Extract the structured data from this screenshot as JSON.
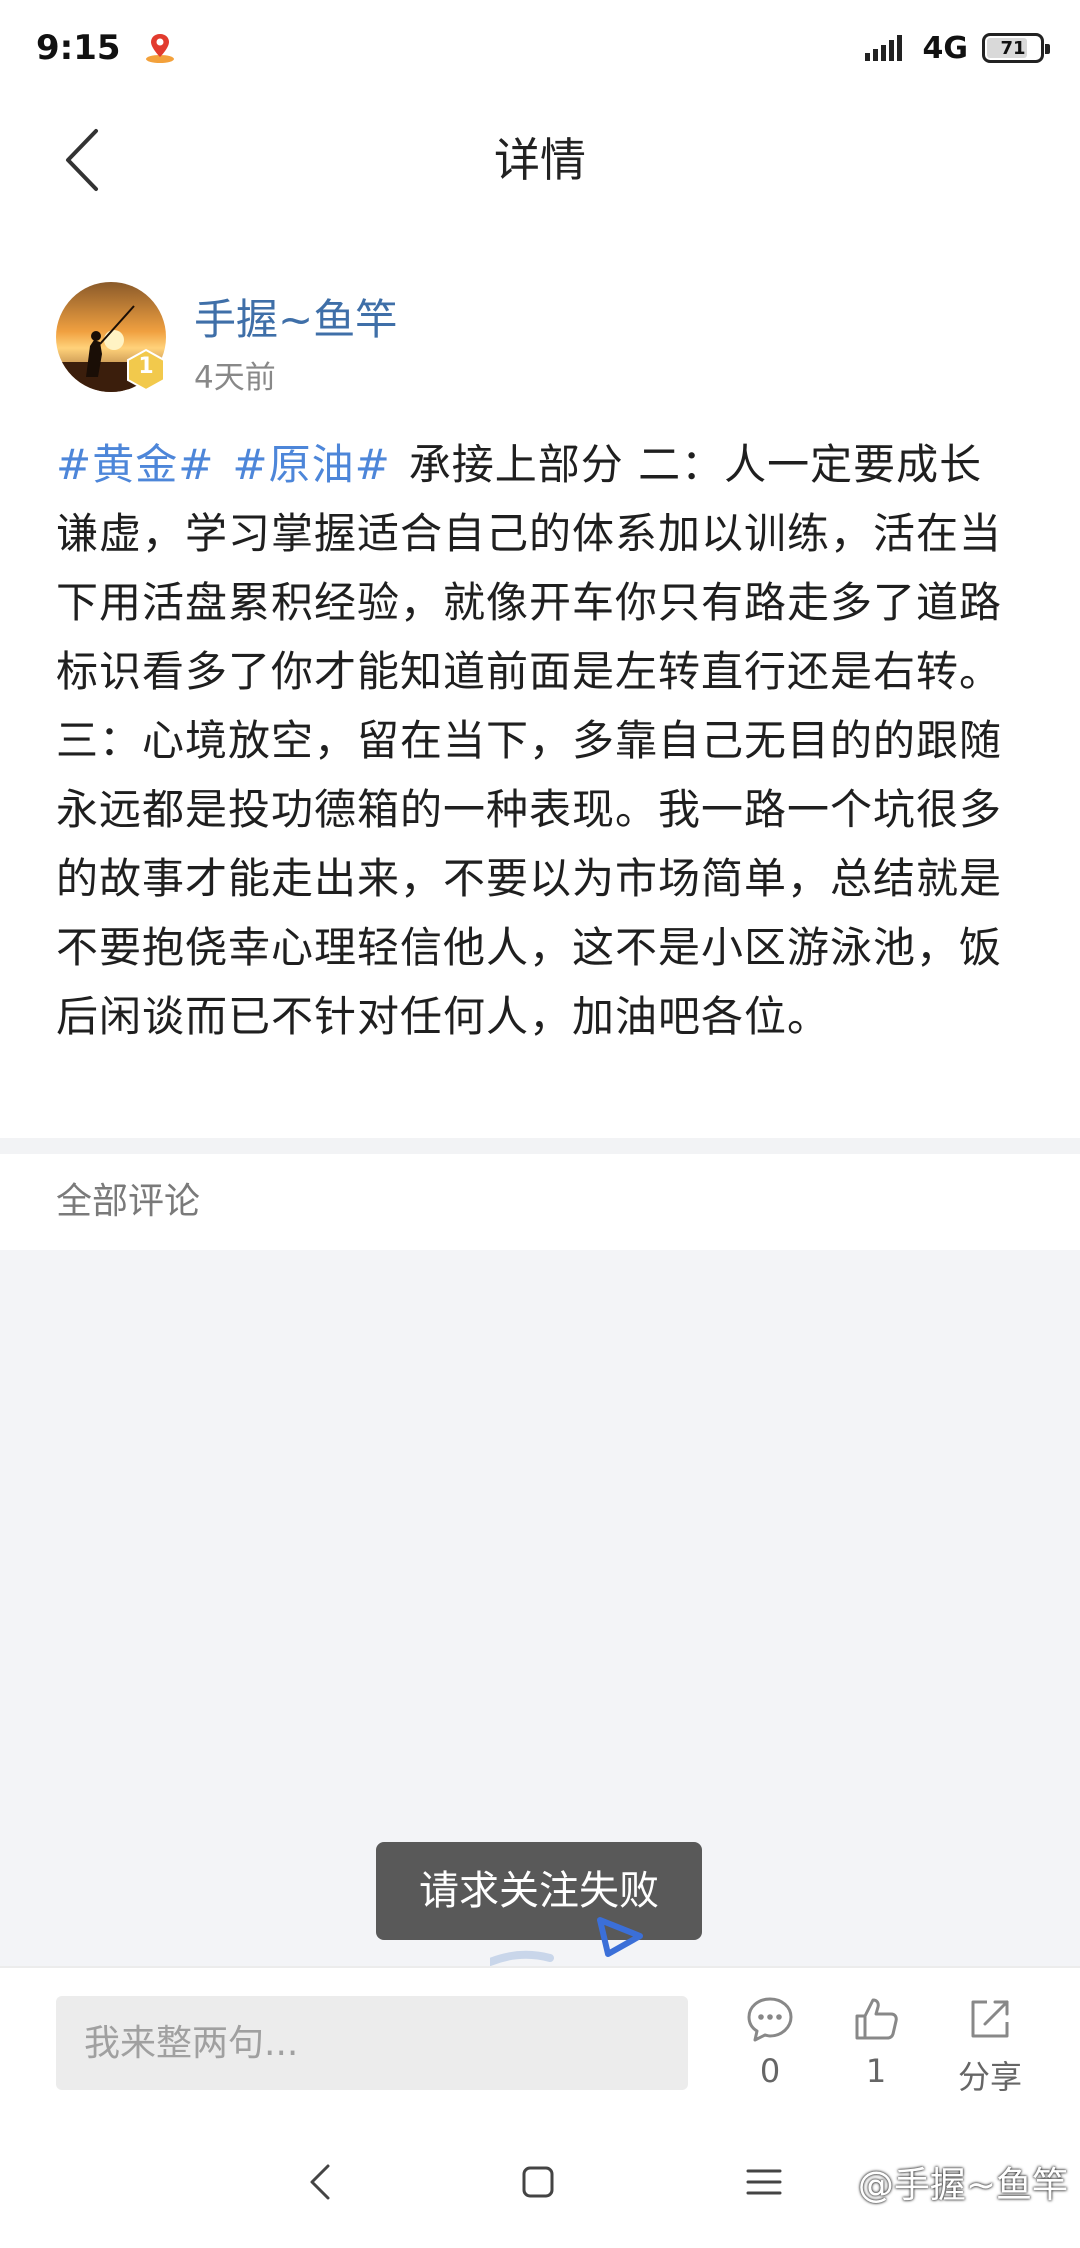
{
  "status_bar": {
    "time": "9:15",
    "app_icon": "red-location-pin-icon",
    "network": "4G",
    "battery_level": "71"
  },
  "header": {
    "title": "详情"
  },
  "post": {
    "author_name": "手握~鱼竿",
    "author_level": "1",
    "time_ago": "4天前",
    "hashtags": [
      "#黄金#",
      "#原油#"
    ],
    "content": "承接上部分 二：人一定要成长谦虚，学习掌握适合自己的体系加以训练，活在当下用活盘累积经验，就像开车你只有路走多了道路标识看多了你才能知道前面是左转直行还是右转。三：心境放空，留在当下，多靠自己无目的的跟随永远都是投功德箱的一种表现。我一路一个坑很多的故事才能走出来，不要以为市场简单，总结就是不要抱侥幸心理轻信他人，这不是小区游泳池，饭后闲谈而已不针对任何人，加油吧各位。"
  },
  "comments": {
    "header": "全部评论"
  },
  "toast": {
    "message": "请求关注失败"
  },
  "action_bar": {
    "input_placeholder": "我来整两句...",
    "comment_count": "0",
    "like_count": "1",
    "share_label": "分享"
  },
  "watermark": "@手握~鱼竿",
  "colors": {
    "link_blue": "#3f6fa8",
    "hashtag_blue": "#4d86d9",
    "toast_bg": "#595959",
    "background_gray": "#f3f4f7"
  }
}
